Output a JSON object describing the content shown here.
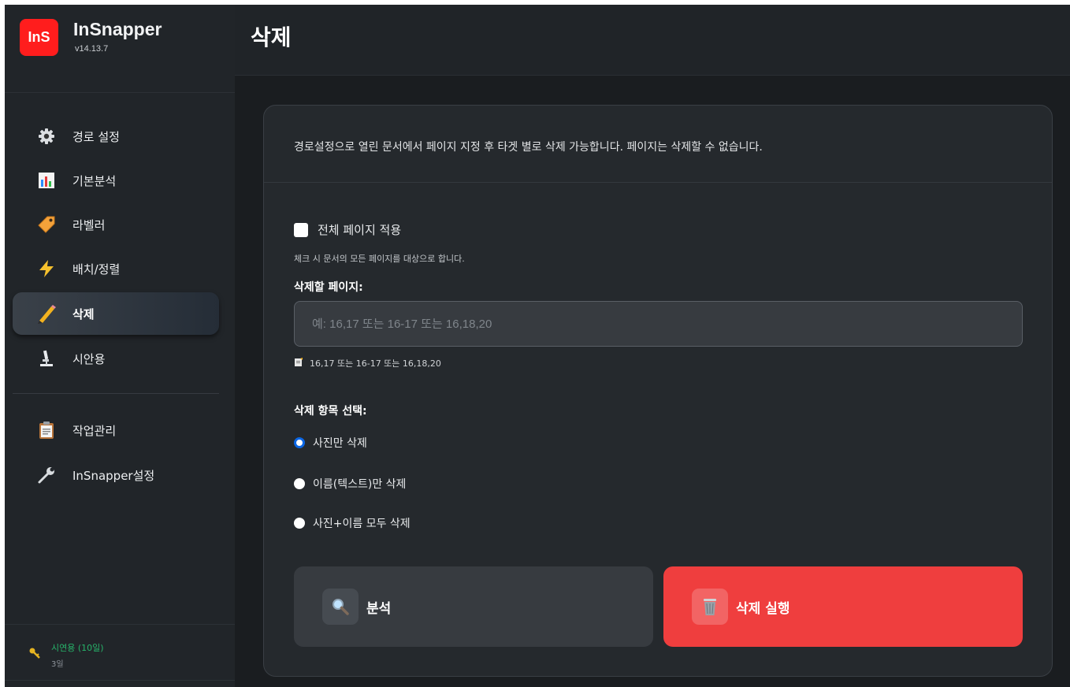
{
  "app": {
    "logo_text": "InS",
    "name": "InSnapper",
    "version": "v14.13.7"
  },
  "sidebar": {
    "items": [
      {
        "label": "경로 설정",
        "icon": "gear-icon"
      },
      {
        "label": "기본분석",
        "icon": "bar-chart-icon"
      },
      {
        "label": "라벨러",
        "icon": "tag-icon"
      },
      {
        "label": "배치/정렬",
        "icon": "lightning-icon"
      },
      {
        "label": "삭제",
        "icon": "pencil-icon",
        "active": true
      },
      {
        "label": "시안용",
        "icon": "microscope-icon"
      },
      {
        "label": "작업관리",
        "icon": "clipboard-icon"
      },
      {
        "label": "InSnapper설정",
        "icon": "wrench-icon"
      }
    ],
    "trial": {
      "title": "시연용 (10일)",
      "sub": "3일",
      "icon": "key-icon"
    }
  },
  "page": {
    "title": "삭제",
    "description": "경로설정으로 열린 문서에서 페이지 지정 후 타겟 별로 삭제 가능합니다. 페이지는 삭제할 수 없습니다.",
    "apply_all": {
      "label": "전체 페이지 적용",
      "checked": false,
      "help": "체크 시 문서의 모든 페이지를 대상으로 합니다."
    },
    "pages_field": {
      "label": "삭제할 페이지:",
      "value": "",
      "placeholder": "예: 16,17 또는 16-17 또는 16,18,20",
      "hint": "16,17 또는 16-17 또는 16,18,20",
      "hint_icon": "memo-icon"
    },
    "delete_target": {
      "title": "삭제 항목 선택:",
      "options": [
        {
          "label": "사진만 삭제",
          "checked": true
        },
        {
          "label": "이름(텍스트)만 삭제",
          "checked": false
        },
        {
          "label": "사진+이름 모두 삭제",
          "checked": false
        }
      ]
    },
    "buttons": {
      "analyze": {
        "label": "분석",
        "icon": "magnifier-icon"
      },
      "execute": {
        "label": "삭제 실행",
        "icon": "trash-icon"
      }
    }
  },
  "colors": {
    "accent_red": "#ef3e3e",
    "logo_red": "#ff1d1d",
    "radio_blue": "#0b66e4",
    "trial_green": "#27b36a"
  }
}
